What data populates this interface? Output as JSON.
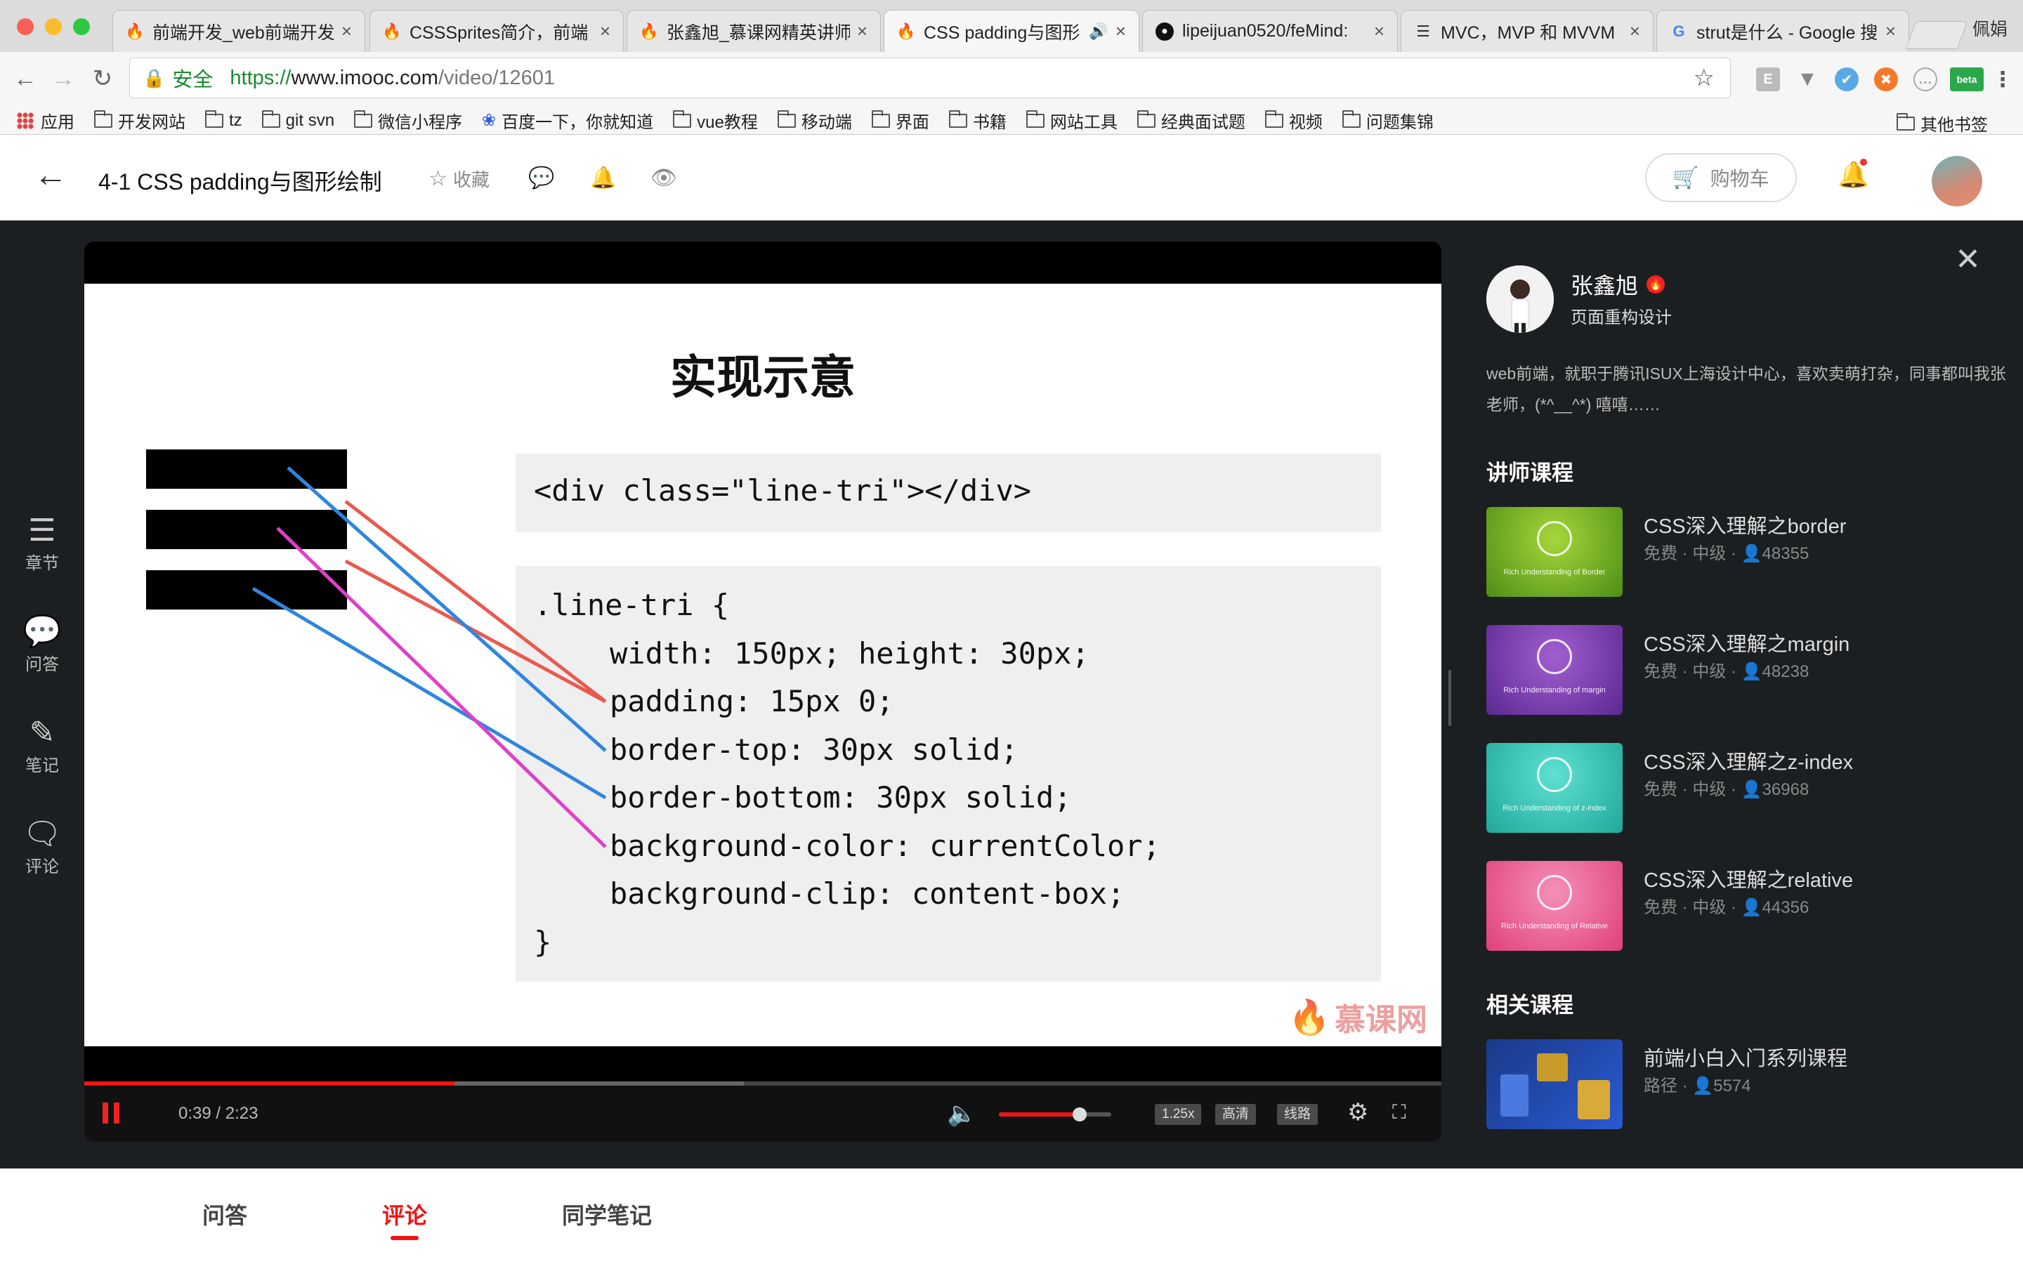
{
  "browser": {
    "tabs": [
      {
        "title": "前端开发_web前端开发",
        "favicon": "flame-icon",
        "active": false
      },
      {
        "title": "CSSSprites简介，前端",
        "favicon": "flame-icon",
        "active": false
      },
      {
        "title": "张鑫旭_慕课网精英讲师",
        "favicon": "flame-icon",
        "active": false
      },
      {
        "title": "CSS padding与图形",
        "favicon": "flame-icon",
        "active": true
      },
      {
        "title": "lipeijuan0520/feMind:",
        "favicon": "github-icon",
        "active": false
      },
      {
        "title": "MVC，MVP 和 MVVM",
        "favicon": "page-icon",
        "active": false
      },
      {
        "title": "strut是什么 - Google 搜",
        "favicon": "google-icon",
        "active": false
      }
    ],
    "profile_name": "佩娟",
    "security_label": "安全",
    "url": {
      "scheme": "https://",
      "host": "www.imooc.com",
      "path": "/video/12601"
    },
    "ext_beta_label": "beta",
    "bookmarks": [
      "应用",
      "开发网站",
      "tz",
      "git svn",
      "微信小程序",
      "百度一下，你就知道",
      "vue教程",
      "移动端",
      "界面",
      "书籍",
      "网站工具",
      "经典面试题",
      "视频",
      "问题集锦"
    ],
    "other_bookmarks": "其他书签"
  },
  "header": {
    "title": "4-1 CSS padding与图形绘制",
    "favorite_label": "收藏",
    "cart_label": "购物车"
  },
  "rail": [
    {
      "label": "章节",
      "icon": "chapters-icon"
    },
    {
      "label": "问答",
      "icon": "qa-icon"
    },
    {
      "label": "笔记",
      "icon": "notes-icon"
    },
    {
      "label": "评论",
      "icon": "comments-icon"
    }
  ],
  "slide": {
    "title": "实现示意",
    "html_code": "<div class=\"line-tri\"></div>",
    "css_lines": [
      ".line-tri {",
      "width: 150px; height: 30px;",
      "padding: 15px 0;",
      "border-top: 30px solid;",
      "border-bottom: 30px solid;",
      "background-color: currentColor;",
      "background-clip: content-box;",
      "}"
    ],
    "watermark": "慕课网",
    "annotation_colors": {
      "padding": "#e85a4f",
      "border": "#2e86de",
      "background": "#e040c8"
    }
  },
  "player": {
    "time": "0:39 / 2:23",
    "progress_fraction": 0.273,
    "buffer_fraction": 0.486,
    "volume_fraction": 0.72,
    "speed_label": "1.25x",
    "quality_label": "高清",
    "route_label": "线路"
  },
  "teacher": {
    "name": "张鑫旭",
    "title": "页面重构设计",
    "bio": "web前端，就职于腾讯ISUX上海设计中心，喜欢卖萌打杂，同事都叫我张老师，(*^__^*) 嘻嘻……"
  },
  "sections": {
    "teacher_courses": "讲师课程",
    "related_courses": "相关课程"
  },
  "courses": [
    {
      "name": "CSS深入理解之border",
      "meta": "免费 · 中级 · ",
      "count": "48355",
      "thumb_caption": "Rich Understanding of Border",
      "color_a": "#a6d63a",
      "color_b": "#4e8e16"
    },
    {
      "name": "CSS深入理解之margin",
      "meta": "免费 · 中级 · ",
      "count": "48238",
      "thumb_caption": "Rich Understanding of margin",
      "color_a": "#a25fd0",
      "color_b": "#5a2890"
    },
    {
      "name": "CSS深入理解之z-index",
      "meta": "免费 · 中级 · ",
      "count": "36968",
      "thumb_caption": "Rich Understanding of z-index",
      "color_a": "#5fe0d0",
      "color_b": "#1fa89a"
    },
    {
      "name": "CSS深入理解之relative",
      "meta": "免费 · 中级 · ",
      "count": "44356",
      "thumb_caption": "Rich Understanding of Relative",
      "color_a": "#f590b8",
      "color_b": "#e0407a"
    }
  ],
  "related": [
    {
      "name": "前端小白入门系列课程",
      "meta": "路径 · ",
      "count": "5574"
    }
  ],
  "bottom_tabs": [
    {
      "label": "问答",
      "active": false
    },
    {
      "label": "评论",
      "active": true
    },
    {
      "label": "同学笔记",
      "active": false
    }
  ]
}
